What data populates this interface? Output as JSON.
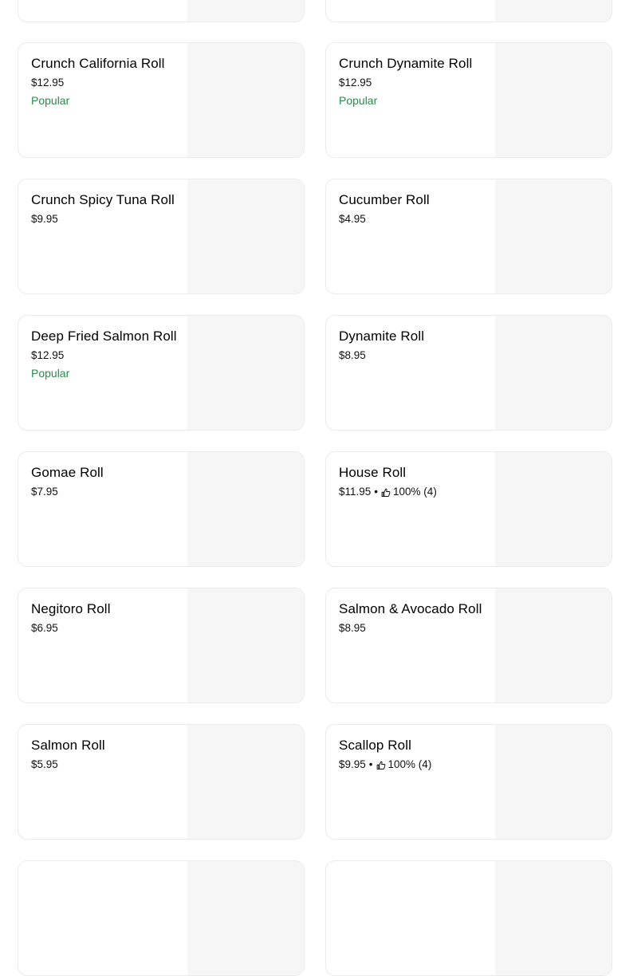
{
  "menu_items": [
    {
      "name": "",
      "price": "",
      "badge": "",
      "rating": ""
    },
    {
      "name": "",
      "price": "",
      "badge": "",
      "rating": ""
    },
    {
      "name": "Crunch California Roll",
      "price": "$12.95",
      "badge": "Popular",
      "rating": ""
    },
    {
      "name": "Crunch Dynamite Roll",
      "price": "$12.95",
      "badge": "Popular",
      "rating": ""
    },
    {
      "name": "Crunch Spicy Tuna Roll",
      "price": "$9.95",
      "badge": "",
      "rating": ""
    },
    {
      "name": "Cucumber Roll",
      "price": "$4.95",
      "badge": "",
      "rating": ""
    },
    {
      "name": "Deep Fried Salmon Roll",
      "price": "$12.95",
      "badge": "Popular",
      "rating": ""
    },
    {
      "name": "Dynamite Roll",
      "price": "$8.95",
      "badge": "",
      "rating": ""
    },
    {
      "name": "Gomae Roll",
      "price": "$7.95",
      "badge": "",
      "rating": ""
    },
    {
      "name": "House Roll",
      "price": "$11.95",
      "badge": "",
      "rating": "100% (4)"
    },
    {
      "name": "Negitoro Roll",
      "price": "$6.95",
      "badge": "",
      "rating": ""
    },
    {
      "name": "Salmon & Avocado Roll",
      "price": "$8.95",
      "badge": "",
      "rating": ""
    },
    {
      "name": "Salmon Roll",
      "price": "$5.95",
      "badge": "",
      "rating": ""
    },
    {
      "name": "Scallop Roll",
      "price": "$9.95",
      "badge": "",
      "rating": "100% (4)"
    },
    {
      "name": "",
      "price": "",
      "badge": "",
      "rating": ""
    },
    {
      "name": "",
      "price": "",
      "badge": "",
      "rating": ""
    }
  ],
  "rating_separator": "•",
  "icons": {
    "rating": "thumbs-up-icon"
  },
  "colors": {
    "popular": "#2b8a4a",
    "thumb_placeholder": "#f6f6f6",
    "card_border": "#ebebeb"
  }
}
